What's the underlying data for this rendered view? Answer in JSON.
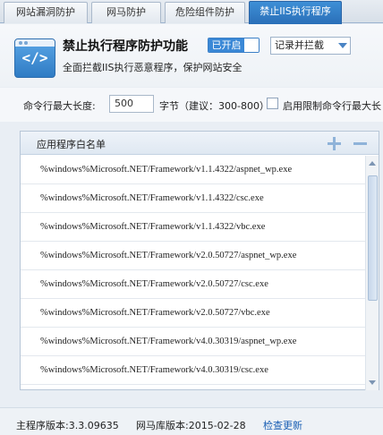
{
  "tabs": [
    {
      "label": "网站漏洞防护",
      "active": false
    },
    {
      "label": "网马防护",
      "active": false
    },
    {
      "label": "危险组件防护",
      "active": false
    },
    {
      "label": "禁止IIS执行程序",
      "active": true
    }
  ],
  "feature": {
    "icon": "code-window-icon",
    "icon_text": "</>",
    "title": "禁止执行程序防护功能",
    "status": "已开启",
    "mode_selected": "记录并拦截",
    "description": "全面拦截IIS执行恶意程序，保护网站安全"
  },
  "options": {
    "max_len_label": "命令行最大长度:",
    "max_len_value": "500",
    "unit_hint": "字节（建议：300-800）",
    "limit_label": "启用限制命令行最大长"
  },
  "whitelist": {
    "title": "应用程序白名单",
    "items": [
      "%windows%Microsoft.NET/Framework/v1.1.4322/aspnet_wp.exe",
      "%windows%Microsoft.NET/Framework/v1.1.4322/csc.exe",
      "%windows%Microsoft.NET/Framework/v1.1.4322/vbc.exe",
      "%windows%Microsoft.NET/Framework/v2.0.50727/aspnet_wp.exe",
      "%windows%Microsoft.NET/Framework/v2.0.50727/csc.exe",
      "%windows%Microsoft.NET/Framework/v2.0.50727/vbc.exe",
      "%windows%Microsoft.NET/Framework/v4.0.30319/aspnet_wp.exe",
      "%windows%Microsoft.NET/Framework/v4.0.30319/csc.exe"
    ]
  },
  "footer": {
    "program_version": "主程序版本:3.3.09635",
    "db_version": "网马库版本:2015-02-28",
    "check_update": "检查更新"
  },
  "colors": {
    "accent": "#2f7cc4",
    "tab_active": "#3e8fd6",
    "link": "#1a5fb4"
  }
}
